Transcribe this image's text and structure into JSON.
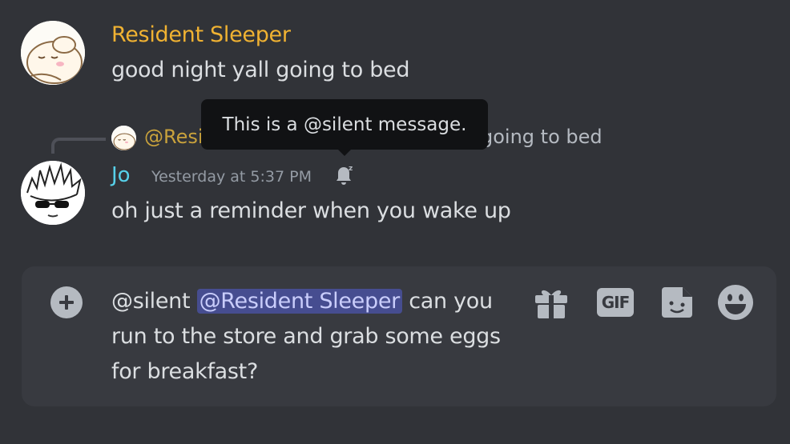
{
  "messages": [
    {
      "author": "Resident Sleeper",
      "author_color": "#f0b232",
      "text": "good night yall going to bed"
    },
    {
      "author": "Jo",
      "author_color": "#57d0e9",
      "timestamp": "Yesterday at 5:37 PM",
      "text": "oh just a reminder when you wake up",
      "reply": {
        "author": "@Resi",
        "text": "going to bed"
      },
      "status_icon": "silent-bell-icon"
    }
  ],
  "tooltip": {
    "text": "This is a @silent message."
  },
  "composer": {
    "prefix": "@silent ",
    "mention": "@Resident Sleeper",
    "text": " can you run to the store and grab some eggs for breakfast?",
    "buttons": {
      "gif_label": "GIF"
    },
    "icons": [
      "add-icon",
      "gift-icon",
      "gif-icon",
      "sticker-icon",
      "emoji-icon"
    ]
  },
  "colors": {
    "background": "#313338",
    "composer": "#383a40",
    "mention": "#5865f2"
  }
}
